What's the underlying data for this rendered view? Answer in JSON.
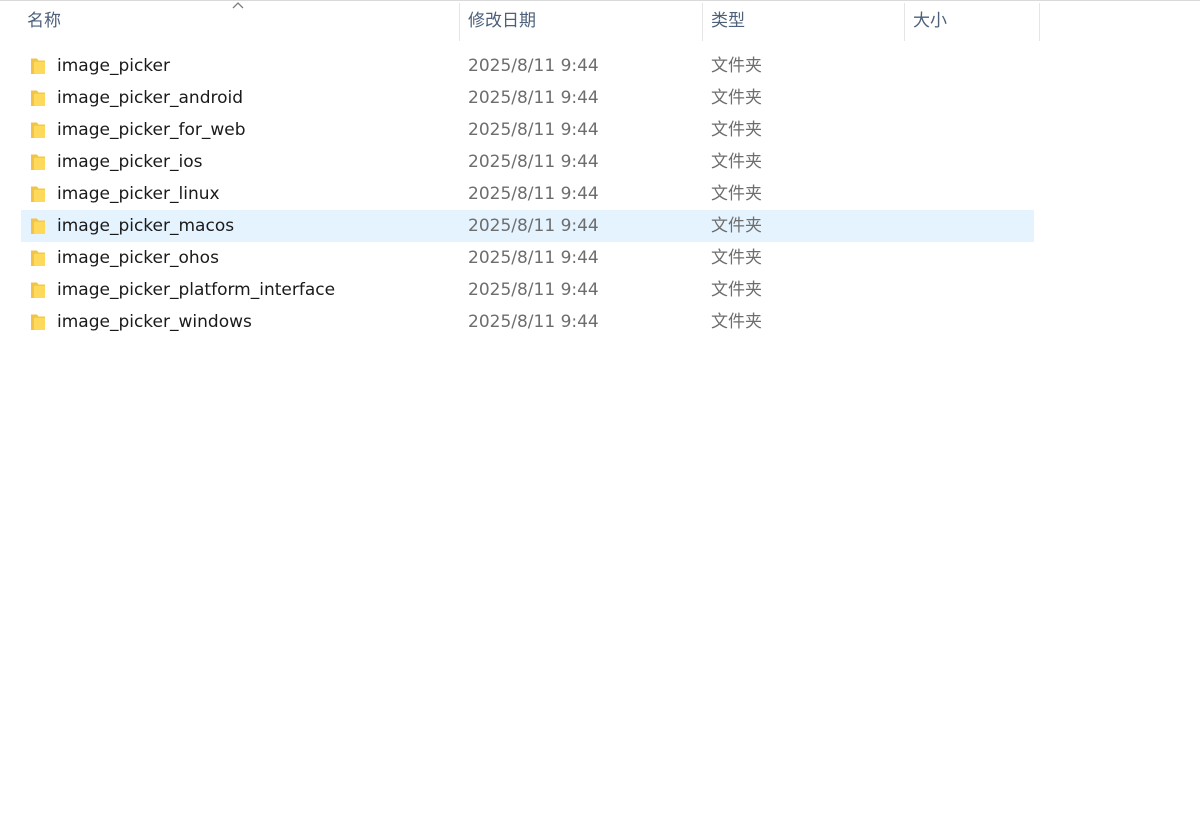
{
  "columns": {
    "name": "名称",
    "date": "修改日期",
    "type": "类型",
    "size": "大小"
  },
  "sort": {
    "column": "name",
    "direction": "ascending",
    "icon": "chevron-up-icon"
  },
  "selection_color": "#e5f3ff",
  "folder_icon": "folder-icon",
  "files": [
    {
      "name": "image_picker",
      "date": "2025/8/11 9:44",
      "type": "文件夹",
      "size": "",
      "selected": false
    },
    {
      "name": "image_picker_android",
      "date": "2025/8/11 9:44",
      "type": "文件夹",
      "size": "",
      "selected": false
    },
    {
      "name": "image_picker_for_web",
      "date": "2025/8/11 9:44",
      "type": "文件夹",
      "size": "",
      "selected": false
    },
    {
      "name": "image_picker_ios",
      "date": "2025/8/11 9:44",
      "type": "文件夹",
      "size": "",
      "selected": false
    },
    {
      "name": "image_picker_linux",
      "date": "2025/8/11 9:44",
      "type": "文件夹",
      "size": "",
      "selected": false
    },
    {
      "name": "image_picker_macos",
      "date": "2025/8/11 9:44",
      "type": "文件夹",
      "size": "",
      "selected": true
    },
    {
      "name": "image_picker_ohos",
      "date": "2025/8/11 9:44",
      "type": "文件夹",
      "size": "",
      "selected": false
    },
    {
      "name": "image_picker_platform_interface",
      "date": "2025/8/11 9:44",
      "type": "文件夹",
      "size": "",
      "selected": false
    },
    {
      "name": "image_picker_windows",
      "date": "2025/8/11 9:44",
      "type": "文件夹",
      "size": "",
      "selected": false
    }
  ]
}
